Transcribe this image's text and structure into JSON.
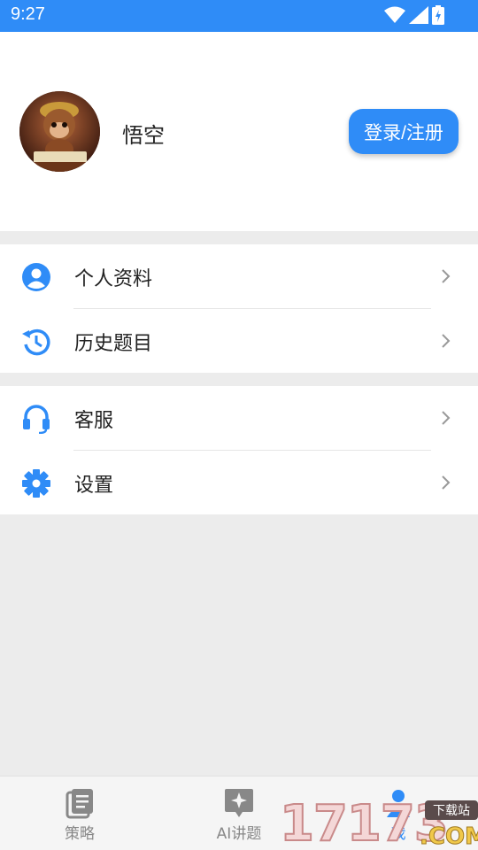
{
  "status_bar": {
    "time": "9:27",
    "icons": [
      "wifi-icon",
      "signal-icon",
      "battery-icon"
    ]
  },
  "profile": {
    "username": "悟空",
    "login_label": "登录/注册",
    "avatar": "monkey-avatar-image"
  },
  "menu": {
    "group1": [
      {
        "label": "个人资料",
        "icon": "person-icon"
      },
      {
        "label": "历史题目",
        "icon": "history-icon"
      }
    ],
    "group2": [
      {
        "label": "客服",
        "icon": "headset-icon"
      },
      {
        "label": "设置",
        "icon": "gear-icon"
      }
    ]
  },
  "tabbar": {
    "tabs": [
      {
        "label": "策略",
        "icon": "list-icon"
      },
      {
        "label": "AI讲题",
        "icon": "sparkle-icon"
      },
      {
        "label": "我",
        "icon": "user-icon"
      }
    ],
    "active_index": 2
  },
  "watermark": {
    "digits": "17173",
    "badge": "下载站",
    "domain": ".COM"
  },
  "colors": {
    "accent": "#2f8cf7",
    "background": "#ececec",
    "text": "#222222",
    "inactive": "#888888"
  }
}
